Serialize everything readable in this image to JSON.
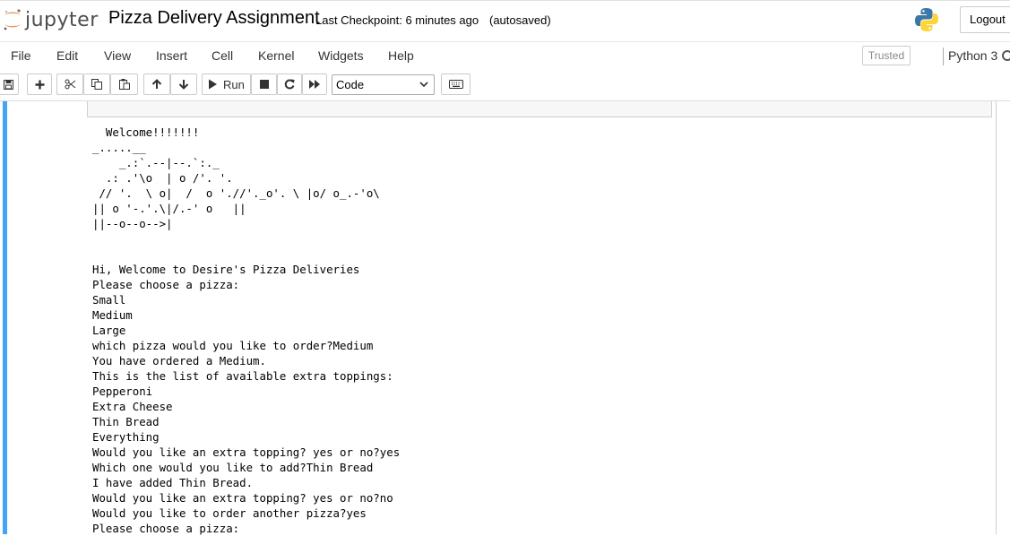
{
  "header": {
    "logo_text": "jupyter",
    "notebook_title": "Pizza Delivery Assignment",
    "checkpoint": "Last Checkpoint: 6 minutes ago",
    "autosave": "(autosaved)",
    "logout_label": "Logout"
  },
  "menubar": {
    "items": [
      "File",
      "Edit",
      "View",
      "Insert",
      "Cell",
      "Kernel",
      "Widgets",
      "Help"
    ],
    "trusted_label": "Trusted",
    "kernel_name": "Python 3"
  },
  "toolbar": {
    "run_label": "Run",
    "cell_type": "Code"
  },
  "output_lines": [
    "  Welcome!!!!!!!",
    "_.....__",
    "    _.:`.--|--.`:._",
    "  .: .'\\o  | o /'. '.",
    " // '.  \\ o|  /  o './/'._o'. \\ |o/ o_.-'o\\",
    "|| o '-.'.\\|/.-' o   ||",
    "||--o--o-->|",
    "",
    "",
    "Hi, Welcome to Desire's Pizza Deliveries",
    "Please choose a pizza:",
    "Small",
    "Medium",
    "Large",
    "which pizza would you like to order?Medium",
    "You have ordered a Medium.",
    "This is the list of available extra toppings:",
    "Pepperoni",
    "Extra Cheese",
    "Thin Bread",
    "Everything",
    "Would you like an extra topping? yes or no?yes",
    "Which one would you like to add?Thin Bread",
    "I have added Thin Bread.",
    "Would you like an extra topping? yes or no?no",
    "Would you like to order another pizza?yes",
    "Please choose a pizza:"
  ],
  "colors": {
    "cell_selected_bar": "#42a5f5",
    "jupyter_orange": "#f37726"
  }
}
